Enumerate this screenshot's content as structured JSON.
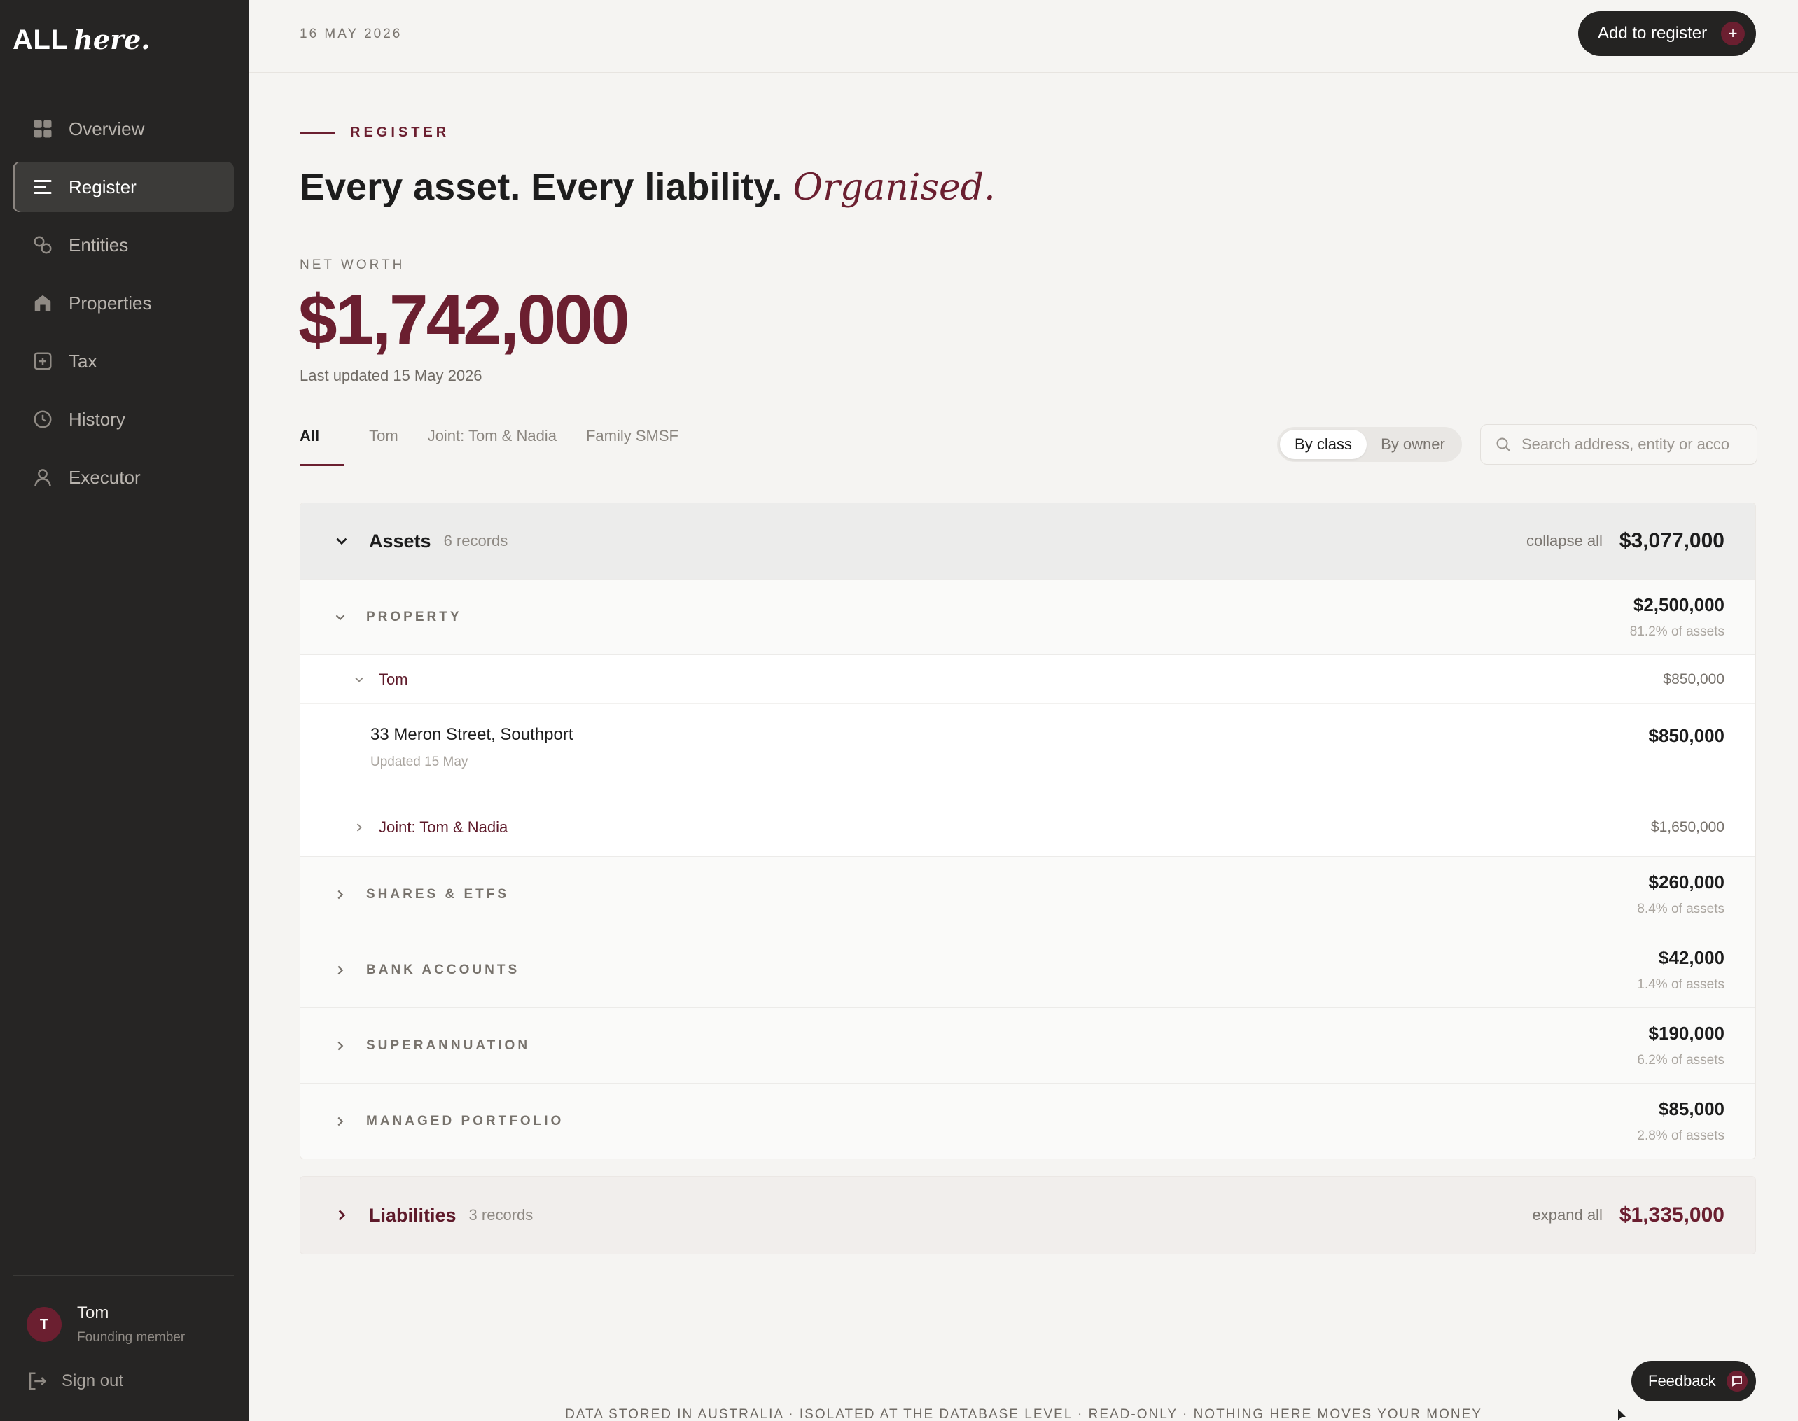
{
  "brand": {
    "name_bold": "ALL",
    "name_script": "here."
  },
  "sidebar": {
    "items": [
      {
        "label": "Overview",
        "icon": "grid-icon"
      },
      {
        "label": "Register",
        "icon": "list-icon",
        "active": true
      },
      {
        "label": "Entities",
        "icon": "entities-icon"
      },
      {
        "label": "Properties",
        "icon": "home-icon"
      },
      {
        "label": "Tax",
        "icon": "plus-square-icon"
      },
      {
        "label": "History",
        "icon": "clock-icon"
      },
      {
        "label": "Executor",
        "icon": "person-icon"
      }
    ],
    "user": {
      "initial": "T",
      "name": "Tom",
      "role": "Founding member"
    },
    "signout_label": "Sign out"
  },
  "topbar": {
    "date": "16 MAY 2026",
    "add_button_label": "Add to register",
    "add_button_icon": "+"
  },
  "page": {
    "eyebrow": "REGISTER",
    "headline": "Every asset. Every liability.",
    "headline_accent": "Organised.",
    "net_worth_label": "NET WORTH",
    "net_worth_value": "$1,742,000",
    "last_updated": "Last updated 15 May 2026"
  },
  "filters": {
    "tabs": [
      "All",
      "Tom",
      "Joint: Tom & Nadia",
      "Family SMSF"
    ],
    "active_tab": "All",
    "view_modes": [
      "By class",
      "By owner"
    ],
    "active_view": "By class",
    "search_placeholder": "Search address, entity or acco",
    "search_value": ""
  },
  "assets": {
    "title": "Assets",
    "count": "6 records",
    "toggle_label": "collapse all",
    "total": "$3,077,000",
    "classes": [
      {
        "label": "PROPERTY",
        "value": "$2,500,000",
        "share": "81.2% of assets",
        "expanded": true,
        "owners": [
          {
            "label": "Tom",
            "value": "$850,000",
            "expanded": true,
            "items": [
              {
                "name": "33 Meron Street, Southport",
                "updated": "Updated 15 May",
                "value": "$850,000"
              }
            ]
          },
          {
            "label": "Joint: Tom & Nadia",
            "value": "$1,650,000",
            "expanded": false
          }
        ]
      },
      {
        "label": "SHARES & ETFS",
        "value": "$260,000",
        "share": "8.4% of assets",
        "expanded": false
      },
      {
        "label": "BANK ACCOUNTS",
        "value": "$42,000",
        "share": "1.4% of assets",
        "expanded": false
      },
      {
        "label": "SUPERANNUATION",
        "value": "$190,000",
        "share": "6.2% of assets",
        "expanded": false
      },
      {
        "label": "MANAGED PORTFOLIO",
        "value": "$85,000",
        "share": "2.8% of assets",
        "expanded": false
      }
    ]
  },
  "liabilities": {
    "title": "Liabilities",
    "count": "3 records",
    "toggle_label": "expand all",
    "total": "$1,335,000"
  },
  "footer": {
    "text": "DATA STORED IN AUSTRALIA · ISOLATED AT THE DATABASE LEVEL · READ-ONLY · NOTHING HERE MOVES YOUR MONEY",
    "feedback_label": "Feedback"
  },
  "colors": {
    "accent": "#6b1f30",
    "sidebar_bg": "#262524",
    "page_bg": "#f5f4f2"
  }
}
